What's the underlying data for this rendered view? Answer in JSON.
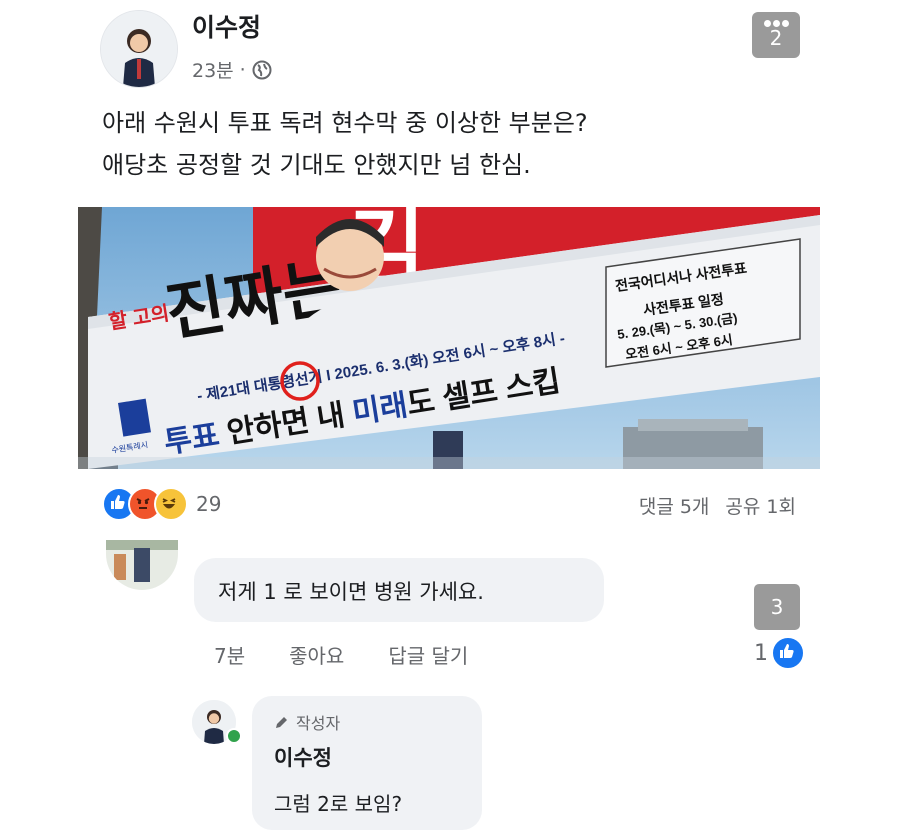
{
  "post": {
    "author": "이수정",
    "time": "23분",
    "separator": "·",
    "text_lines": [
      "아래 수원시 투표 독려 현수막 중 이상한 부분은?",
      "애당초 공정할 것 기대도 안했지만 넘 한심."
    ],
    "more_badge": "2"
  },
  "banner": {
    "top_tag": "할 고의",
    "headline": "진짜는",
    "right_red": "김",
    "election_line": "- 제21대 대통령선거 I 2025. 6. 3.(화) 오전 6시 ~ 오후 8시 -",
    "slogan_a": "투표",
    "slogan_b": " 안하면 내 ",
    "slogan_c": "미래",
    "slogan_d": "도 셀프 스킵",
    "early_title": "전국어디서나 사전투표",
    "early_sub": "사전투표 일정",
    "early_dates": "5. 29.(목) ~ 5. 30.(금)",
    "early_hours": "오전 6시 ~ 오후 6시",
    "city_label": "수원특례시"
  },
  "reactions": {
    "count": "29",
    "comments": "댓글 5개",
    "shares": "공유 1회"
  },
  "comment1": {
    "text": "저게 1 로 보이면 병원 가세요.",
    "time": "7분",
    "like_label": "좋아요",
    "reply_label": "답글 달기",
    "badge": "3",
    "like_count": "1"
  },
  "reply": {
    "tag": "작성자",
    "author": "이수정",
    "text": "그럼 2로 보임?"
  },
  "colors": {
    "facebook_blue": "#1877f2",
    "banner_red": "#d3202a",
    "bubble_gray": "#f0f2f5",
    "annotation_circle": "#e0201c"
  }
}
